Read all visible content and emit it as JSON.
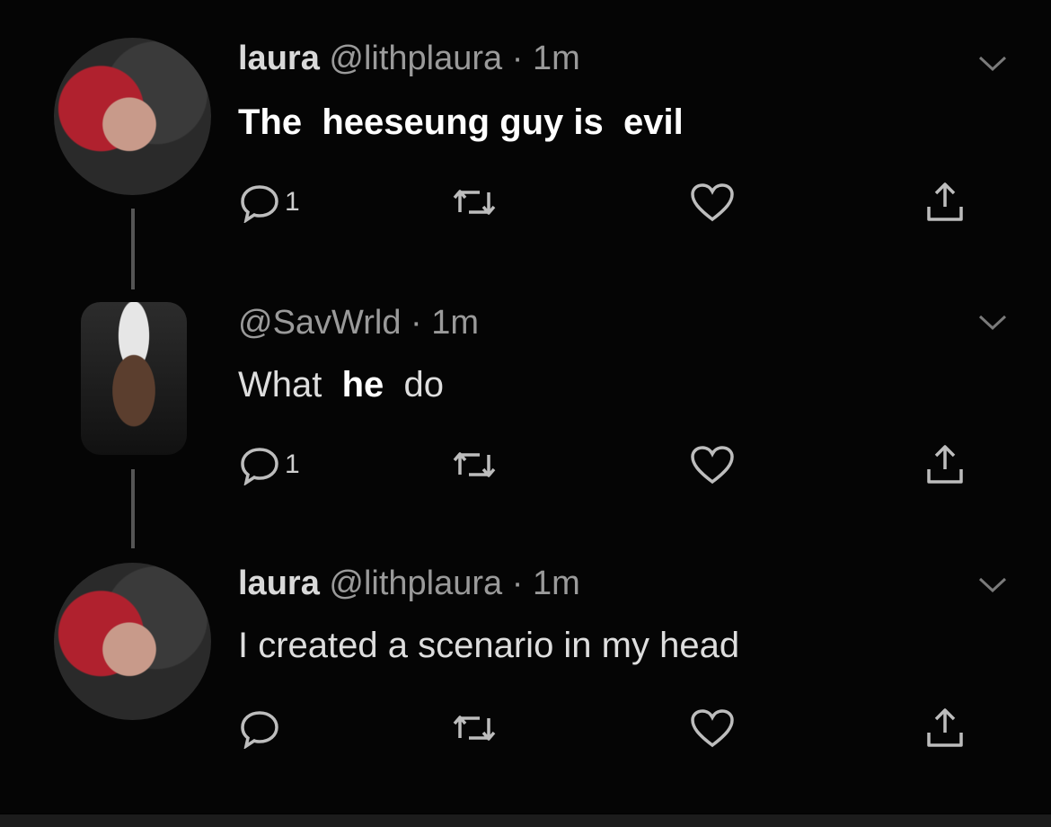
{
  "tweets": [
    {
      "display_name": "laura",
      "handle": "@lithplaura",
      "time": "· 1m",
      "text_parts": [
        "The",
        "heeseung guy is",
        "evil"
      ],
      "reply_count": "1"
    },
    {
      "display_name": "",
      "handle": "@SavWrld",
      "time": "· 1m",
      "text_parts": [
        "What",
        "he",
        "do"
      ],
      "reply_count": "1"
    },
    {
      "display_name": "laura",
      "handle": "@lithplaura",
      "time": "· 1m",
      "text_parts": [
        "I created a scenario in my head"
      ],
      "reply_count": ""
    }
  ],
  "icons": {
    "reply": "reply-icon",
    "retweet": "retweet-icon",
    "like": "heart-icon",
    "share": "share-icon",
    "more": "chevron-down-icon"
  },
  "colors": {
    "background": "#050505",
    "primary_text": "#dedede",
    "secondary_text": "#9a9a9a",
    "icon": "#bdbdbd"
  }
}
